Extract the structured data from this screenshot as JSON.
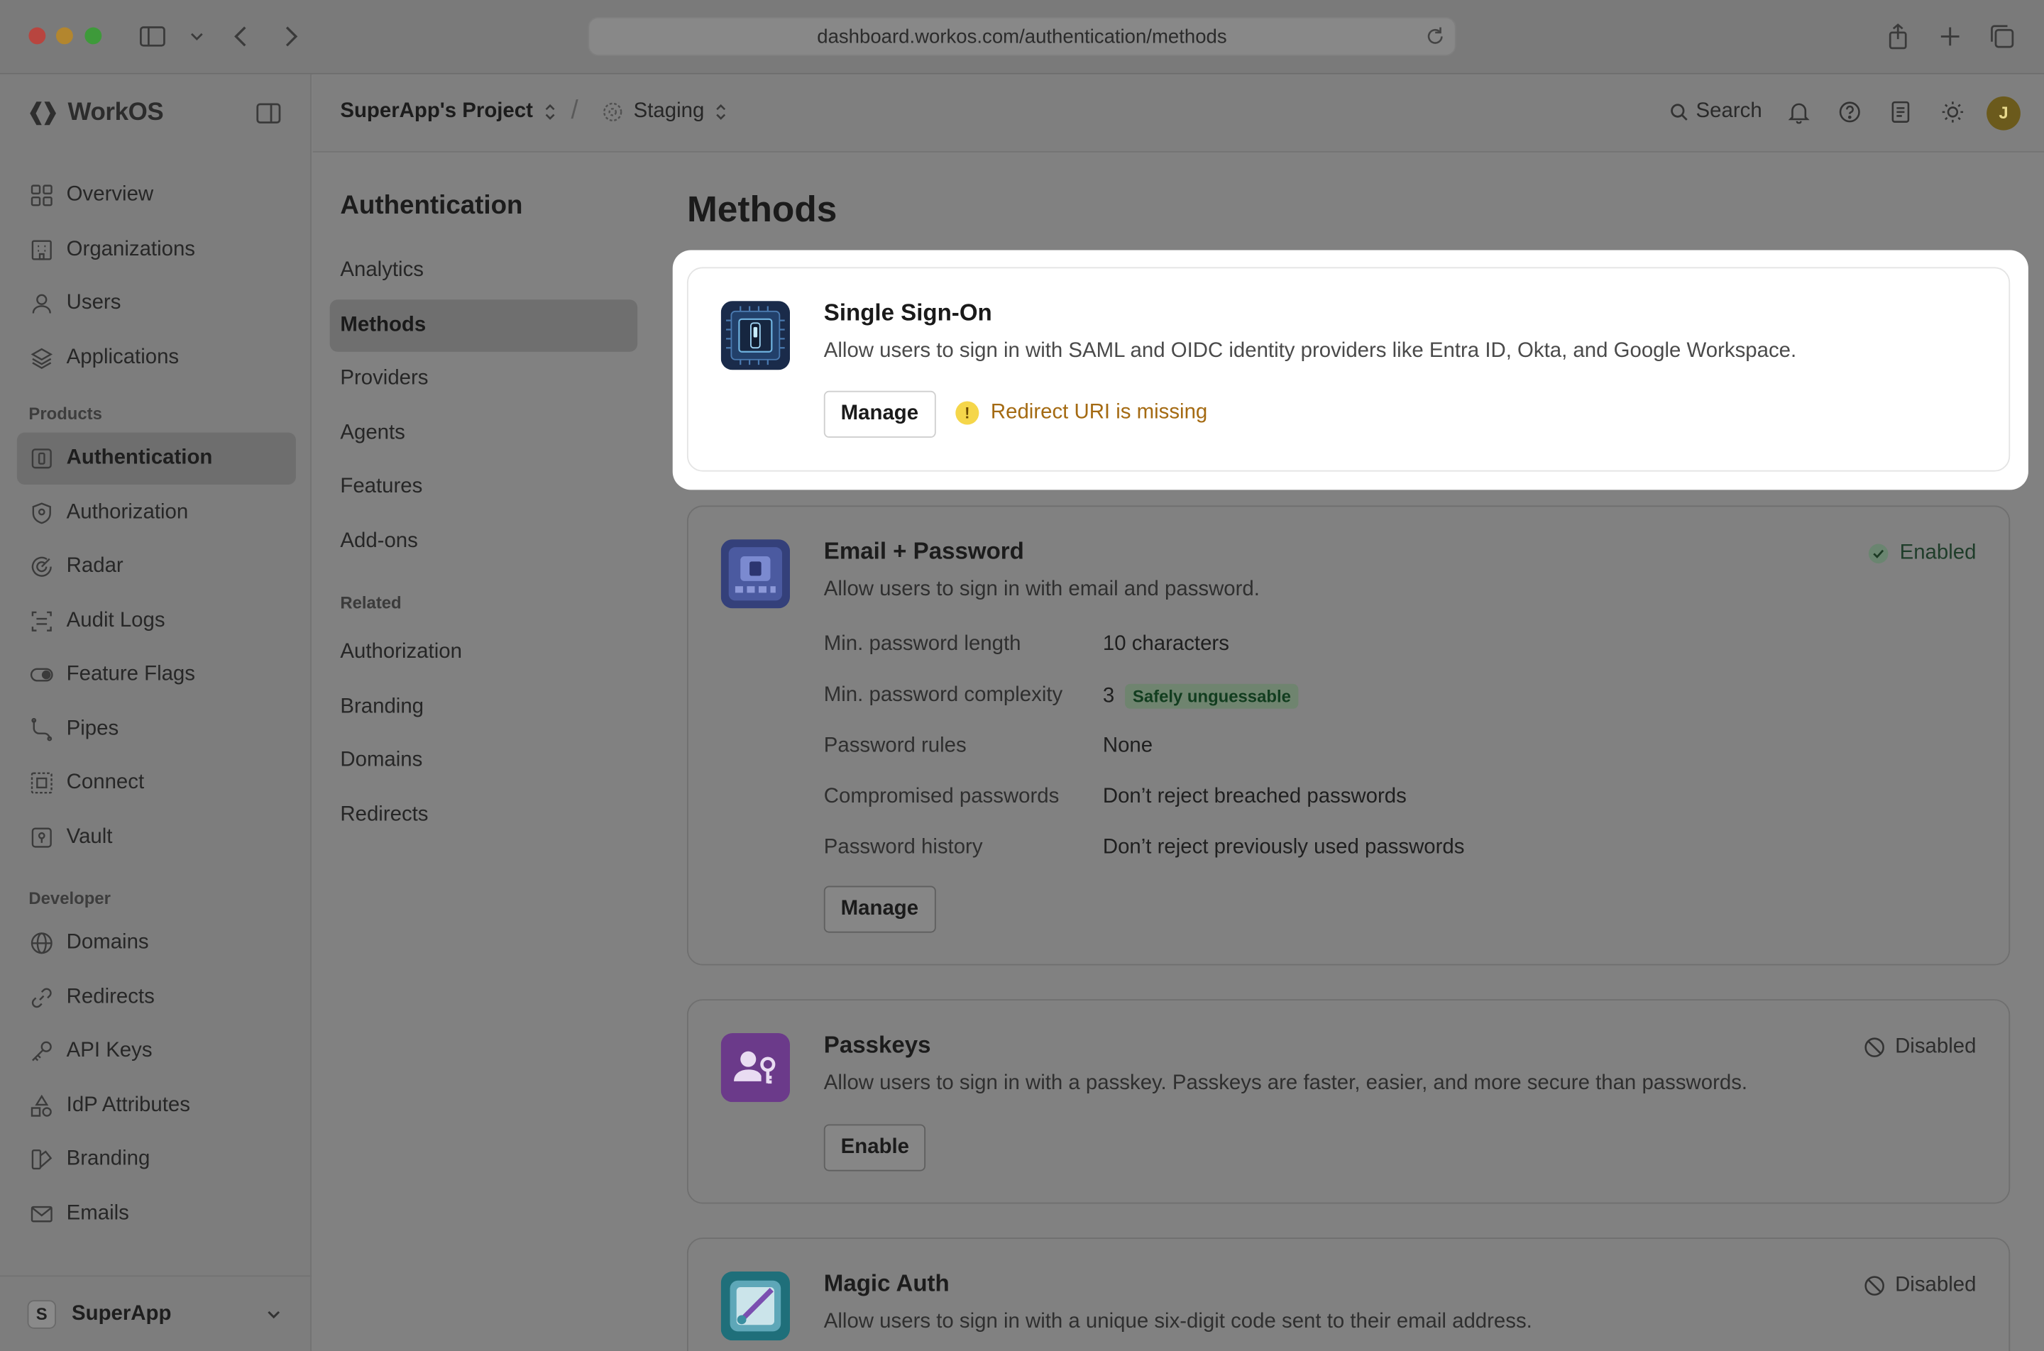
{
  "browser": {
    "url": "dashboard.workos.com/authentication/methods"
  },
  "brand": {
    "name": "WorkOS"
  },
  "sidebar": {
    "items": [
      {
        "label": "Overview",
        "icon": "grid-icon"
      },
      {
        "label": "Organizations",
        "icon": "building-icon"
      },
      {
        "label": "Users",
        "icon": "user-icon"
      },
      {
        "label": "Applications",
        "icon": "layers-icon"
      }
    ],
    "products_label": "Products",
    "products": [
      {
        "label": "Authentication",
        "icon": "auth-icon",
        "active": true
      },
      {
        "label": "Authorization",
        "icon": "shield-icon"
      },
      {
        "label": "Radar",
        "icon": "radar-icon"
      },
      {
        "label": "Audit Logs",
        "icon": "audit-icon"
      },
      {
        "label": "Feature Flags",
        "icon": "toggle-icon"
      },
      {
        "label": "Pipes",
        "icon": "pipes-icon"
      },
      {
        "label": "Connect",
        "icon": "connect-icon"
      },
      {
        "label": "Vault",
        "icon": "vault-icon"
      }
    ],
    "developer_label": "Developer",
    "developer": [
      {
        "label": "Domains",
        "icon": "globe-icon"
      },
      {
        "label": "Redirects",
        "icon": "link-icon"
      },
      {
        "label": "API Keys",
        "icon": "key-icon"
      },
      {
        "label": "IdP Attributes",
        "icon": "shapes-icon"
      },
      {
        "label": "Branding",
        "icon": "brush-icon"
      },
      {
        "label": "Emails",
        "icon": "mail-icon"
      }
    ],
    "workspace": {
      "initial": "S",
      "name": "SuperApp"
    }
  },
  "header": {
    "project": "SuperApp's Project",
    "separator": "/",
    "environment": "Staging",
    "search": "Search",
    "user_initial": "J"
  },
  "subnav": {
    "title": "Authentication",
    "items": [
      "Analytics",
      "Methods",
      "Providers",
      "Agents",
      "Features",
      "Add-ons"
    ],
    "active": "Methods",
    "related_label": "Related",
    "related": [
      "Authorization",
      "Branding",
      "Domains",
      "Redirects"
    ]
  },
  "main": {
    "title": "Methods",
    "sso": {
      "title": "Single Sign-On",
      "description": "Allow users to sign in with SAML and OIDC identity providers like Entra ID, Okta, and Google Workspace.",
      "button": "Manage",
      "warning": "Redirect URI is missing"
    },
    "email_password": {
      "title": "Email + Password",
      "description": "Allow users to sign in with email and password.",
      "status": "Enabled",
      "settings": [
        {
          "label": "Min. password length",
          "value": "10 characters"
        },
        {
          "label": "Min. password complexity",
          "value": "3",
          "badge": "Safely unguessable"
        },
        {
          "label": "Password rules",
          "value": "None"
        },
        {
          "label": "Compromised passwords",
          "value": "Don’t reject breached passwords"
        },
        {
          "label": "Password history",
          "value": "Don’t reject previously used passwords"
        }
      ],
      "button": "Manage"
    },
    "passkeys": {
      "title": "Passkeys",
      "description": "Allow users to sign in with a passkey. Passkeys are faster, easier, and more secure than passwords.",
      "status": "Disabled",
      "button": "Enable"
    },
    "magic_auth": {
      "title": "Magic Auth",
      "description": "Allow users to sign in with a unique six-digit code sent to their email address.",
      "status": "Disabled"
    }
  },
  "colors": {
    "warning": "#a46a12",
    "enabled": "#1f3d2a",
    "sso_icon_bg": "#1a2b4a",
    "email_icon_bg": "#34407a",
    "passkey_icon_bg": "#6b3a8a",
    "magic_icon_bg": "#1f6f7a"
  }
}
